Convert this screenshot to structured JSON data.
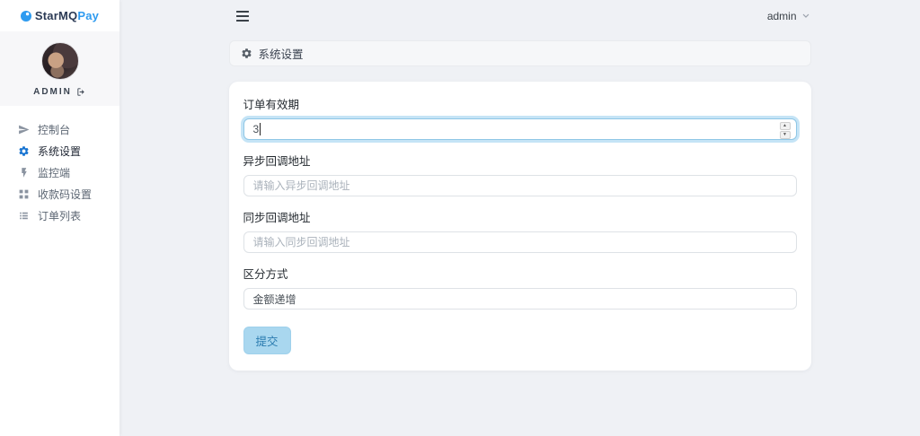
{
  "brand": {
    "icon": "brand-dot-icon",
    "name": "StarMQ",
    "suffix": "Pay"
  },
  "profile": {
    "username": "ADMIN",
    "logout_icon": "logout-icon"
  },
  "sidebar": {
    "items": [
      {
        "label": "控制台",
        "icon": "paper-plane-icon",
        "active": false
      },
      {
        "label": "系统设置",
        "icon": "gear-icon",
        "active": true
      },
      {
        "label": "监控端",
        "icon": "lightning-icon",
        "active": false
      },
      {
        "label": "收款码设置",
        "icon": "grid-icon",
        "active": false
      },
      {
        "label": "订单列表",
        "icon": "list-icon",
        "active": false
      }
    ]
  },
  "topbar": {
    "menu_toggle_icon": "hamburger-icon",
    "user": "admin",
    "chevron_icon": "chevron-down-icon"
  },
  "page": {
    "title": "系统设置",
    "title_icon": "gear-icon"
  },
  "form": {
    "fields": [
      {
        "label": "订单有效期",
        "value": "3",
        "type": "number",
        "focused": true
      },
      {
        "label": "异步回调地址",
        "placeholder": "请输入异步回调地址",
        "type": "text"
      },
      {
        "label": "同步回调地址",
        "placeholder": "请输入同步回调地址",
        "type": "text"
      },
      {
        "label": "区分方式",
        "value": "金额递增",
        "type": "text"
      }
    ],
    "submit_label": "提交"
  },
  "colors": {
    "brand_dark": "#2b3a55",
    "brand_accent": "#2e9bf0",
    "active_icon": "#1673d1",
    "page_bg": "#eff1f5",
    "focus_ring": "#96ceee",
    "submit_bg": "#a9d7ef",
    "submit_text": "#2b7cb0"
  }
}
